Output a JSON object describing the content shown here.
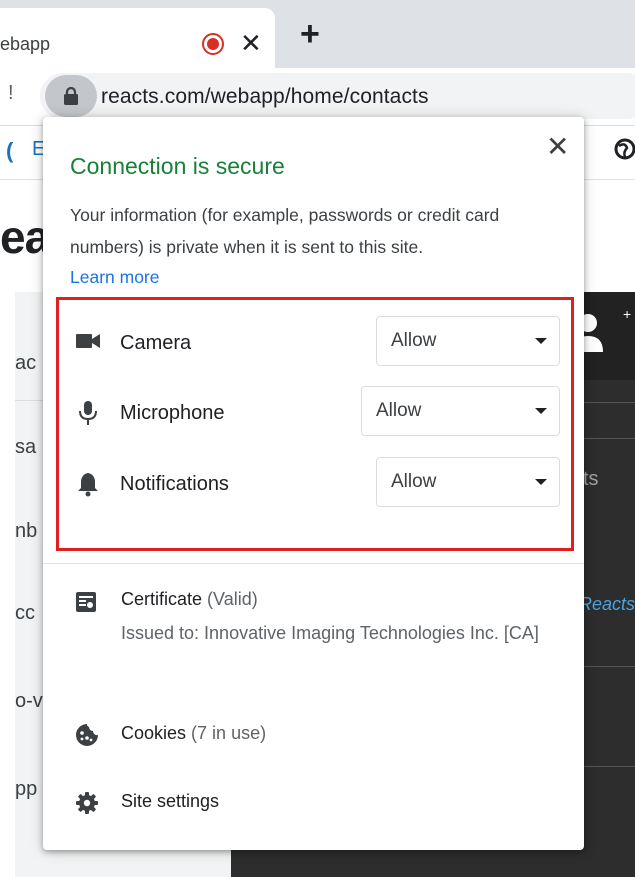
{
  "browser": {
    "tab_title": "ebapp",
    "tab_close_glyph": "✕",
    "new_tab_glyph": "+",
    "toolbar_glyph": "!",
    "url": "reacts.com/webapp/home/contacts",
    "icons": [
      "recording-icon",
      "lock-icon"
    ]
  },
  "background_page": {
    "brand_mark": "(",
    "brand_letter": "E",
    "heading": "ea",
    "sidebar_items": [
      "ac",
      "sa",
      "nb",
      "cc",
      "o-v",
      "pp"
    ],
    "dark_text_1": "ts",
    "dark_text_2": "Reacts",
    "dark_plus": "+"
  },
  "popup": {
    "close_glyph": "✕",
    "title": "Connection is secure",
    "description": "Your information (for example, passwords or credit card numbers) is private when it is sent to this site.",
    "learn_more": "Learn more",
    "title_color": "#188038",
    "link_color": "#1a73e8",
    "highlight_color": "#e02020",
    "permissions": [
      {
        "icon": "camera-icon",
        "label": "Camera",
        "value": "Allow"
      },
      {
        "icon": "microphone-icon",
        "label": "Microphone",
        "value": "Allow"
      },
      {
        "icon": "bell-icon",
        "label": "Notifications",
        "value": "Allow"
      }
    ],
    "certificate": {
      "icon": "certificate-icon",
      "label": "Certificate",
      "status": "(Valid)",
      "issued_to": "Issued to: Innovative Imaging Technologies Inc. [CA]"
    },
    "cookies": {
      "icon": "cookie-icon",
      "label": "Cookies",
      "count": "(7 in use)"
    },
    "site_settings": {
      "icon": "gear-icon",
      "label": "Site settings"
    }
  }
}
